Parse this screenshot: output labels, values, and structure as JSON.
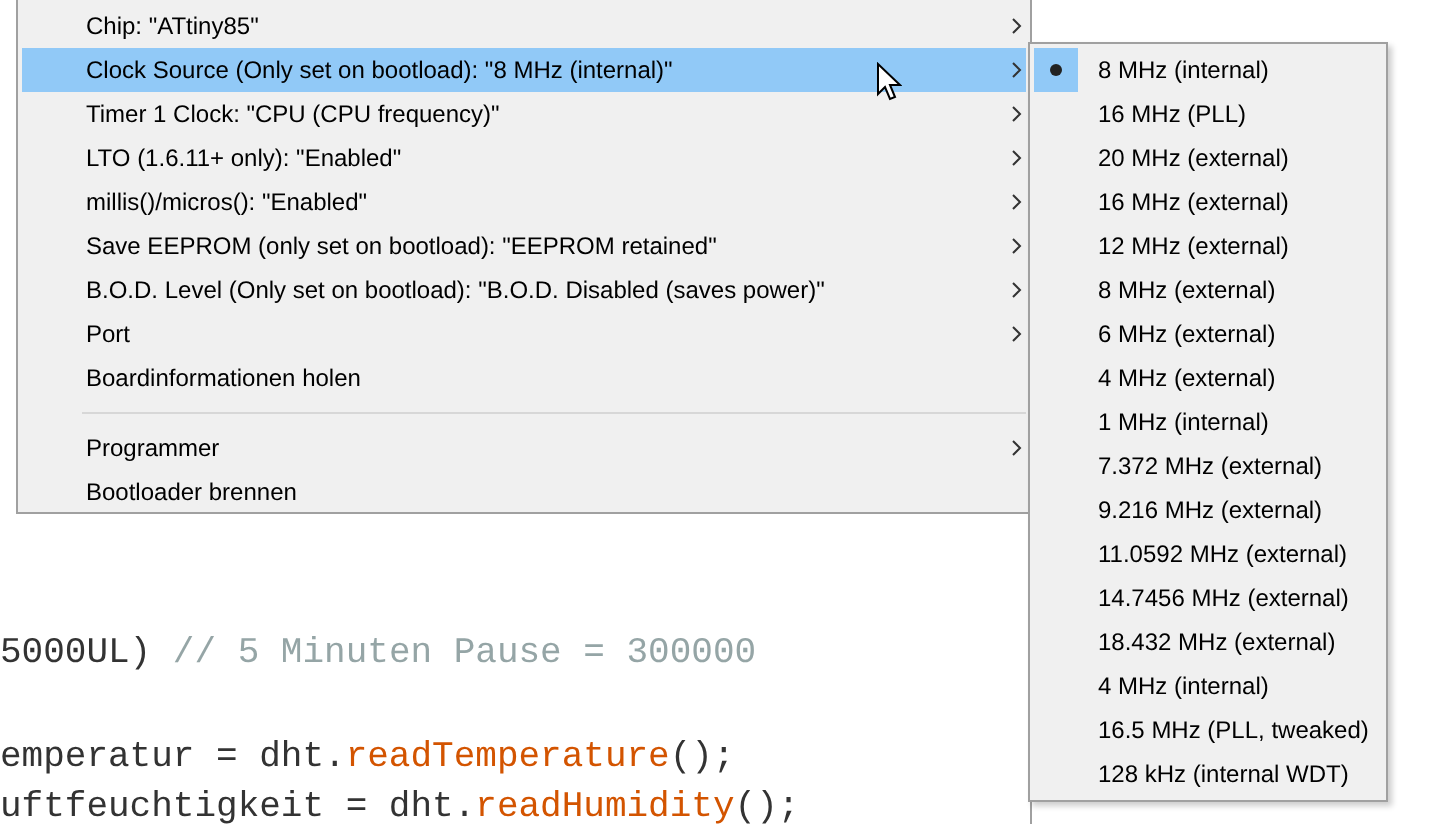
{
  "code_lines": [
    {
      "tokens": [
        {
          "kind": "plain",
          "text": "5000UL) "
        },
        {
          "kind": "comment",
          "text": "// 5 Minuten Pause = 300000"
        }
      ]
    },
    {
      "tokens": [
        {
          "kind": "plain",
          "text": "emperatur = dht."
        },
        {
          "kind": "function",
          "text": "readTemperature"
        },
        {
          "kind": "plain",
          "text": "();"
        }
      ]
    },
    {
      "tokens": [
        {
          "kind": "plain",
          "text": "uftfeuchtigkeit = dht."
        },
        {
          "kind": "function",
          "text": "readHumidity"
        },
        {
          "kind": "plain",
          "text": "();"
        }
      ]
    }
  ],
  "menu": {
    "groups": [
      [
        {
          "label": "Chip: \"ATtiny85\"",
          "submenu": true,
          "selected": false
        },
        {
          "label": "Clock Source (Only set on bootload): \"8 MHz (internal)\"",
          "submenu": true,
          "selected": true
        },
        {
          "label": "Timer 1 Clock: \"CPU (CPU frequency)\"",
          "submenu": true,
          "selected": false
        },
        {
          "label": "LTO (1.6.11+ only): \"Enabled\"",
          "submenu": true,
          "selected": false
        },
        {
          "label": "millis()/micros(): \"Enabled\"",
          "submenu": true,
          "selected": false
        },
        {
          "label": "Save EEPROM (only set on bootload): \"EEPROM retained\"",
          "submenu": true,
          "selected": false
        },
        {
          "label": "B.O.D. Level (Only set on bootload): \"B.O.D. Disabled (saves power)\"",
          "submenu": true,
          "selected": false
        },
        {
          "label": "Port",
          "submenu": true,
          "selected": false
        },
        {
          "label": "Boardinformationen holen",
          "submenu": false,
          "selected": false
        }
      ],
      [
        {
          "label": "Programmer",
          "submenu": true,
          "selected": false
        },
        {
          "label": "Bootloader brennen",
          "submenu": false,
          "selected": false
        }
      ]
    ]
  },
  "submenu": {
    "items": [
      {
        "label": "8 MHz (internal)",
        "selected": true
      },
      {
        "label": "16 MHz (PLL)",
        "selected": false
      },
      {
        "label": "20 MHz (external)",
        "selected": false
      },
      {
        "label": "16 MHz (external)",
        "selected": false
      },
      {
        "label": "12 MHz (external)",
        "selected": false
      },
      {
        "label": "8 MHz (external)",
        "selected": false
      },
      {
        "label": "6 MHz (external)",
        "selected": false
      },
      {
        "label": "4 MHz (external)",
        "selected": false
      },
      {
        "label": "1 MHz (internal)",
        "selected": false
      },
      {
        "label": "7.372 MHz (external)",
        "selected": false
      },
      {
        "label": "9.216 MHz (external)",
        "selected": false
      },
      {
        "label": "11.0592 MHz (external)",
        "selected": false
      },
      {
        "label": "14.7456 MHz (external)",
        "selected": false
      },
      {
        "label": "18.432 MHz (external)",
        "selected": false
      },
      {
        "label": "4 MHz (internal)",
        "selected": false
      },
      {
        "label": "16.5 MHz (PLL, tweaked)",
        "selected": false
      },
      {
        "label": "128 kHz (internal WDT)",
        "selected": false
      }
    ]
  }
}
